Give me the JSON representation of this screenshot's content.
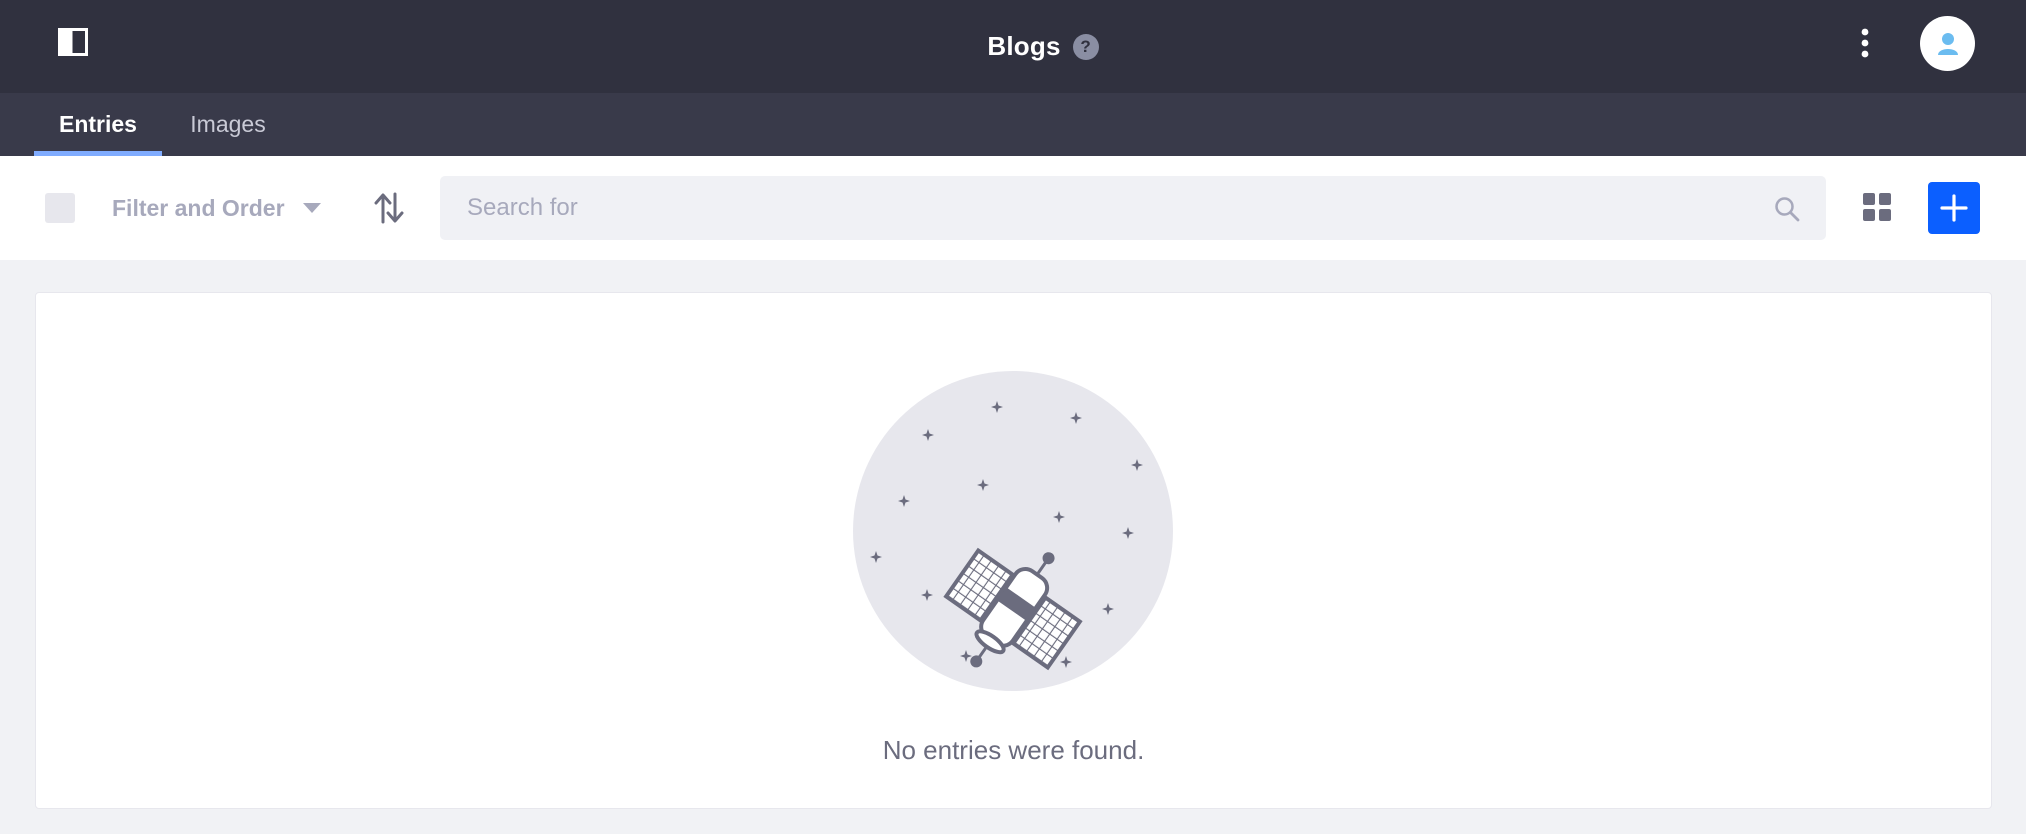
{
  "colors": {
    "topbar": "#30313f",
    "tabsbar": "#393a4a",
    "active_tab_indicator": "#80acff",
    "primary": "#0b5fff",
    "page_background": "#f1f2f5",
    "muted_text": "#a7a9bc"
  },
  "header": {
    "title": "Blogs",
    "help_glyph": "?",
    "sidebar_toggle_icon": "sidebar-panel-icon",
    "options_icon": "ellipsis-vertical-icon",
    "user_icon": "user-avatar-icon"
  },
  "tabs": [
    {
      "label": "Entries",
      "active": true
    },
    {
      "label": "Images",
      "active": false
    }
  ],
  "toolbar": {
    "filter_label": "Filter and Order",
    "search_placeholder": "Search for",
    "sort_icon": "order-arrows-icon",
    "view_icon": "cards-view-icon",
    "add_icon": "plus-icon"
  },
  "empty_state": {
    "message": "No entries were found.",
    "illustration": "satellite-in-space-illustration"
  }
}
